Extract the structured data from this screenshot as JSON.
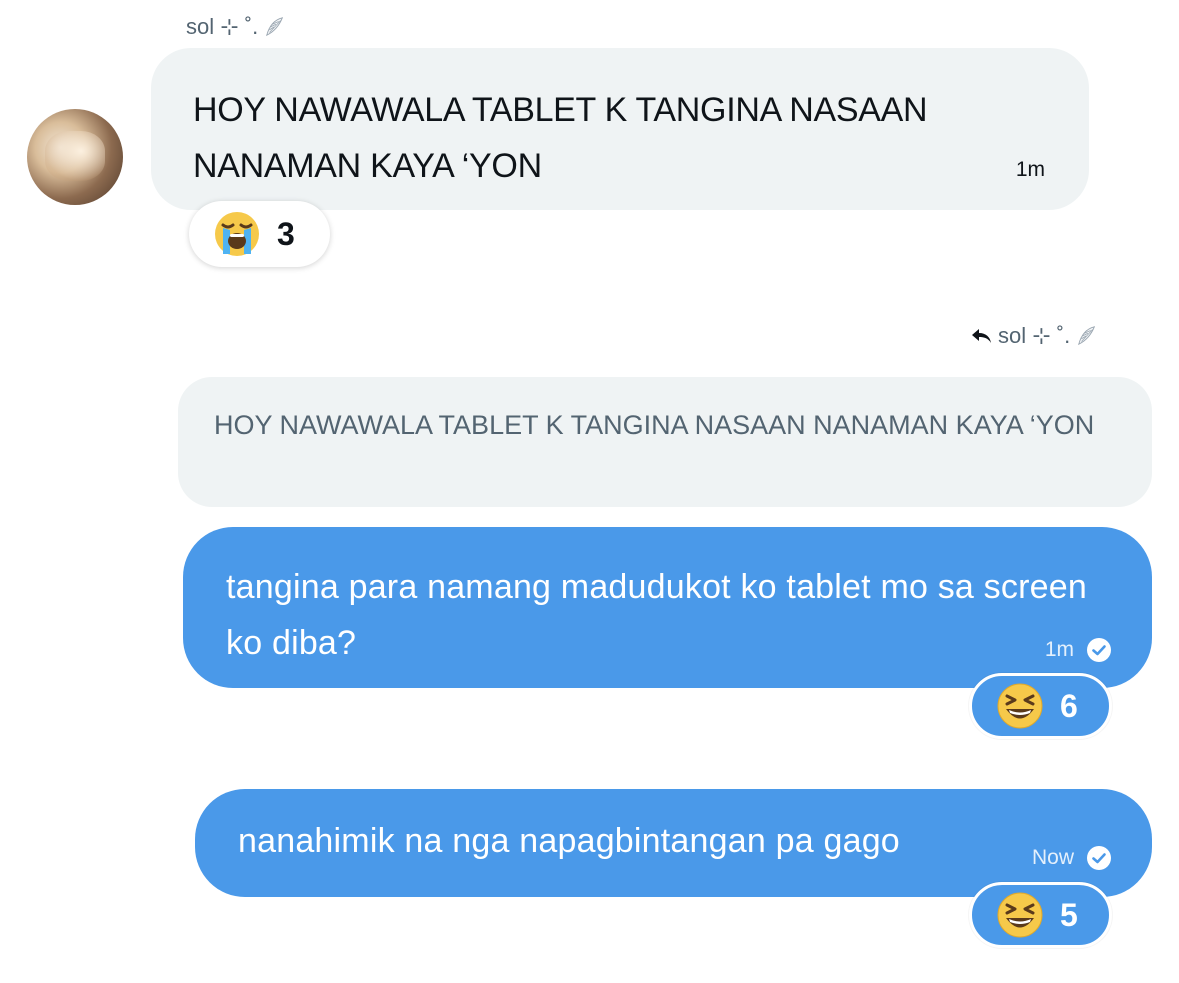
{
  "thread": {
    "sender_name": "sol ⊹ ˚.",
    "incoming": {
      "text": "HOY NAWAWALA TABLET K TANGINA NASAAN NANAMAN KAYA ‘YON",
      "time": "1m",
      "reaction": {
        "emoji": "loudly-crying-face",
        "count": "3"
      }
    },
    "reply_to": {
      "label": "sol ⊹ ˚.",
      "quoted_text": "HOY NAWAWALA TABLET K TANGINA NASAAN NANAMAN KAYA ‘YON"
    },
    "outgoing": [
      {
        "text": "tangina para namang madudukot ko tablet mo sa screen ko diba?",
        "time": "1m",
        "reaction": {
          "emoji": "grinning-squinting-face",
          "count": "6"
        }
      },
      {
        "text": "nanahimik na nga napagbintangan pa gago",
        "time": "Now",
        "reaction": {
          "emoji": "grinning-squinting-face",
          "count": "5"
        }
      }
    ]
  },
  "colors": {
    "outgoing_bubble": "#4a99e9",
    "incoming_bubble": "#eff3f4",
    "secondary_text": "#536471"
  }
}
